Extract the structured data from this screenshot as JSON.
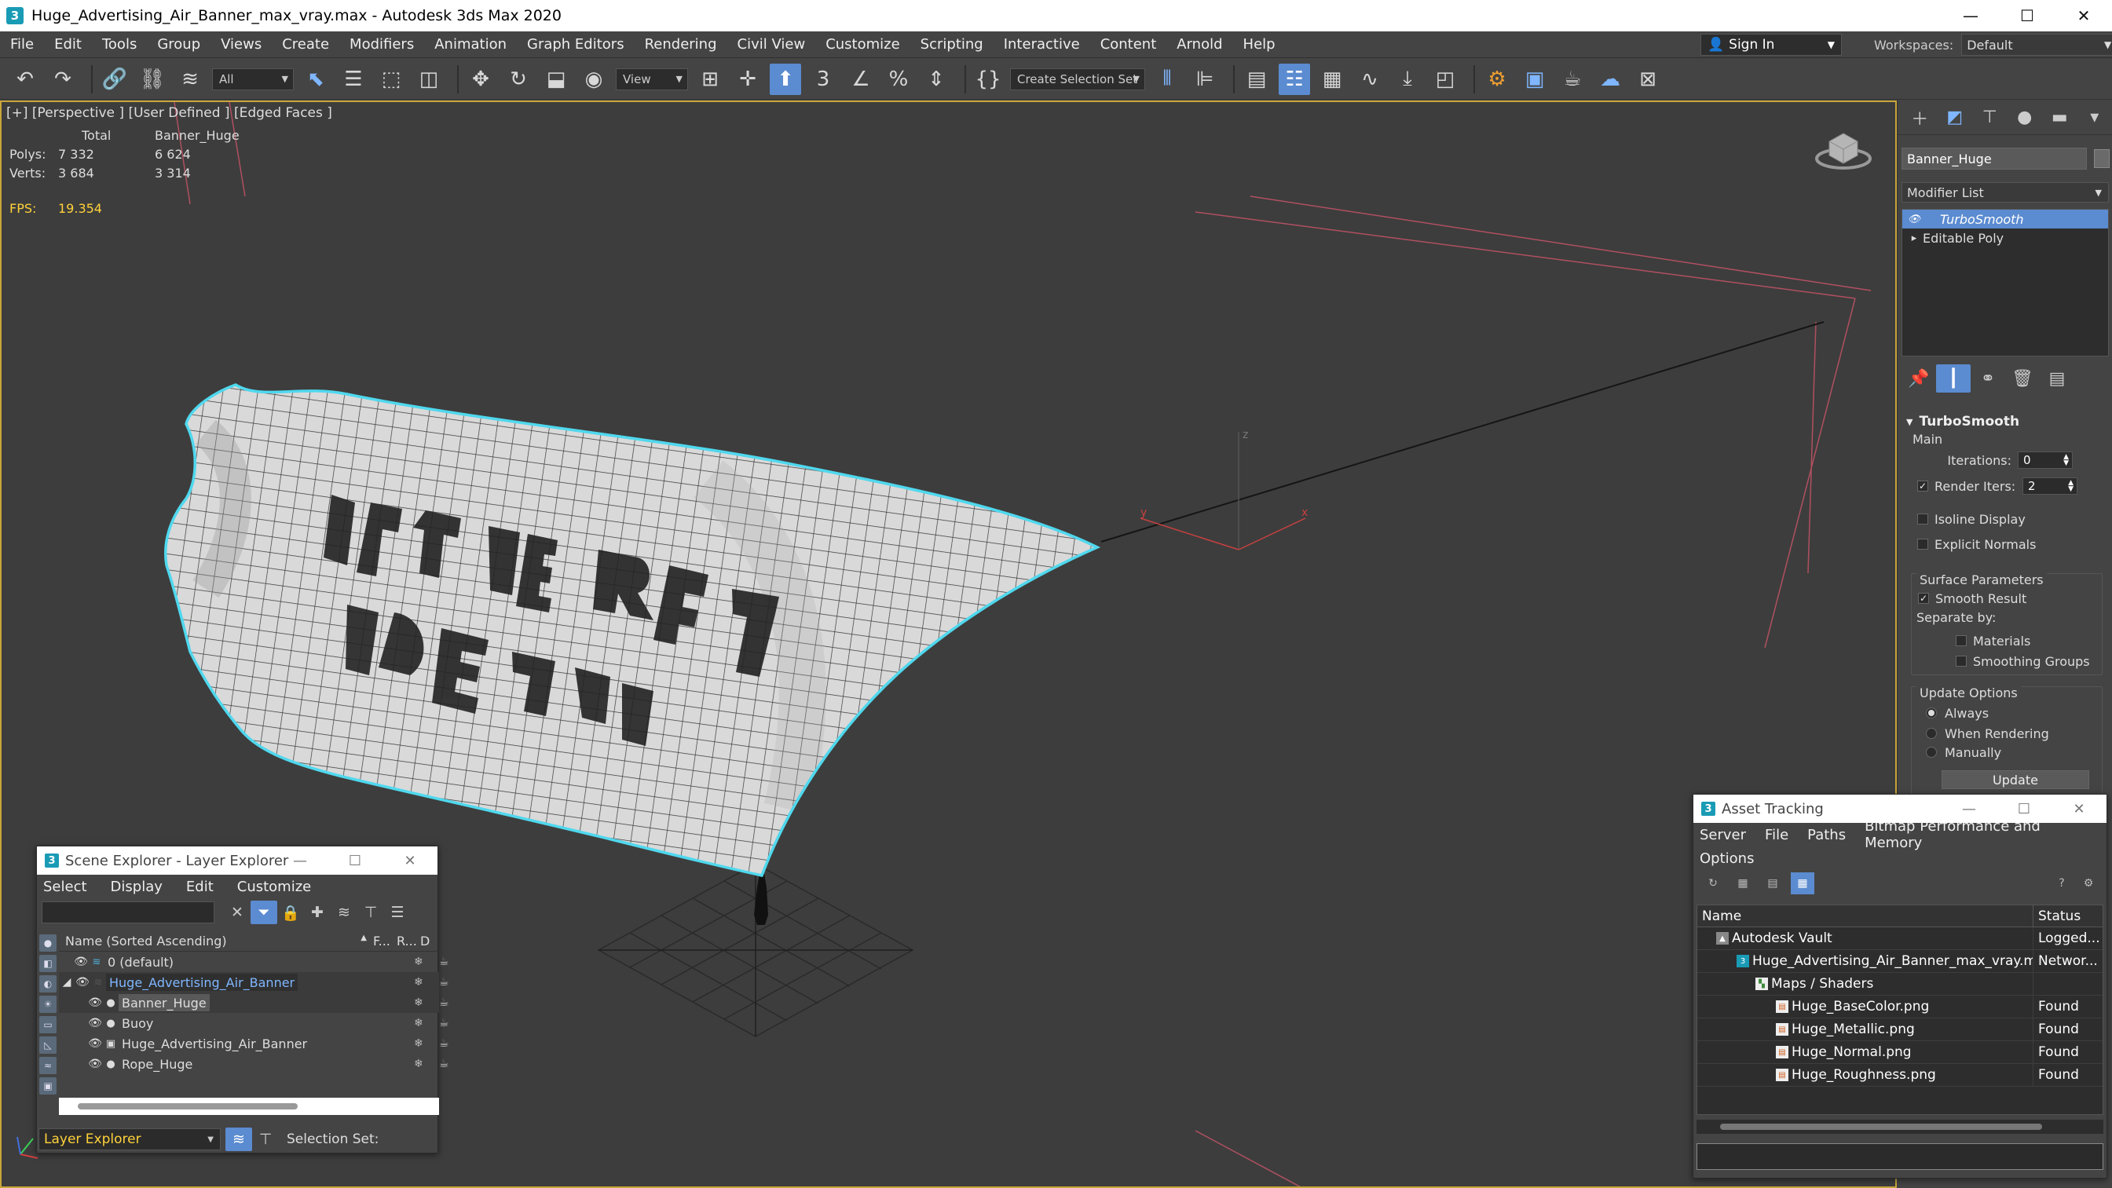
{
  "window": {
    "title": "Huge_Advertising_Air_Banner_max_vray.max - Autodesk 3ds Max 2020",
    "app_icon": "3",
    "minimize": "—",
    "maximize": "☐",
    "close": "✕"
  },
  "menubar": {
    "items": [
      "File",
      "Edit",
      "Tools",
      "Group",
      "Views",
      "Create",
      "Modifiers",
      "Animation",
      "Graph Editors",
      "Rendering",
      "Civil View",
      "Customize",
      "Scripting",
      "Interactive",
      "Content",
      "Arnold",
      "Help"
    ],
    "sign_in": "Sign In",
    "workspaces_label": "Workspaces:",
    "workspaces_value": "Default"
  },
  "toolbar": {
    "selection_filter": "All",
    "ref_coord": "View",
    "create_selection_set": "Create Selection Set",
    "snap_label": "3"
  },
  "viewport": {
    "label": "[+] [Perspective ] [User Defined ] [Edged Faces ]",
    "stats": {
      "col_total": "Total",
      "col_object": "Banner_Huge",
      "polys_label": "Polys:",
      "polys_total": "7 332",
      "polys_object": "6 624",
      "verts_label": "Verts:",
      "verts_total": "3 684",
      "verts_object": "3 314",
      "fps_label": "FPS:",
      "fps_value": "19.354"
    },
    "axis_x": "x",
    "axis_y": "y",
    "axis_z": "z"
  },
  "command_panel": {
    "object_name": "Banner_Huge",
    "modifier_list": "Modifier List",
    "stack": [
      {
        "label": "TurboSmooth",
        "selected": true
      },
      {
        "label": "Editable Poly",
        "selected": false
      }
    ],
    "rollout_title": "TurboSmooth",
    "main_label": "Main",
    "iterations_label": "Iterations:",
    "iterations_value": "0",
    "render_iters_label": "Render Iters:",
    "render_iters_value": "2",
    "isoline_display": "Isoline Display",
    "explicit_normals": "Explicit Normals",
    "surface_parameters": "Surface Parameters",
    "smooth_result": "Smooth Result",
    "separate_by": "Separate by:",
    "materials": "Materials",
    "smoothing_groups": "Smoothing Groups",
    "update_options": "Update Options",
    "always": "Always",
    "when_rendering": "When Rendering",
    "manually": "Manually",
    "update_button": "Update"
  },
  "scene_explorer": {
    "title": "Scene Explorer - Layer Explorer",
    "menu": [
      "Select",
      "Display",
      "Edit",
      "Customize"
    ],
    "col_name": "Name (Sorted Ascending)",
    "col_f": "F...",
    "col_r": "R...",
    "col_d": "D",
    "rows": [
      {
        "name": "0 (default)",
        "indent": 0
      },
      {
        "name": "Huge_Advertising_Air_Banner",
        "indent": 0
      },
      {
        "name": "Banner_Huge",
        "indent": 1
      },
      {
        "name": "Buoy",
        "indent": 1
      },
      {
        "name": "Huge_Advertising_Air_Banner",
        "indent": 1
      },
      {
        "name": "Rope_Huge",
        "indent": 1
      }
    ],
    "layer_dropdown": "Layer Explorer",
    "selection_set": "Selection Set:"
  },
  "asset_tracking": {
    "title": "Asset Tracking",
    "menu": [
      "Server",
      "File",
      "Paths",
      "Bitmap Performance and Memory"
    ],
    "menu2": "Options",
    "col_name": "Name",
    "col_status": "Status",
    "rows": [
      {
        "name": "Autodesk Vault",
        "status": "Logged...",
        "indent": 0
      },
      {
        "name": "Huge_Advertising_Air_Banner_max_vray.max",
        "status": "Networ...",
        "indent": 1
      },
      {
        "name": "Maps / Shaders",
        "status": "",
        "indent": 2
      },
      {
        "name": "Huge_BaseColor.png",
        "status": "Found",
        "indent": 3
      },
      {
        "name": "Huge_Metallic.png",
        "status": "Found",
        "indent": 3
      },
      {
        "name": "Huge_Normal.png",
        "status": "Found",
        "indent": 3
      },
      {
        "name": "Huge_Roughness.png",
        "status": "Found",
        "indent": 3
      }
    ]
  },
  "colors": {
    "accent": "#5b8bd0",
    "stats": "#ffd23a",
    "selection_outline": "#4fd8ee",
    "viewport_bg": "#3d3d3d"
  }
}
